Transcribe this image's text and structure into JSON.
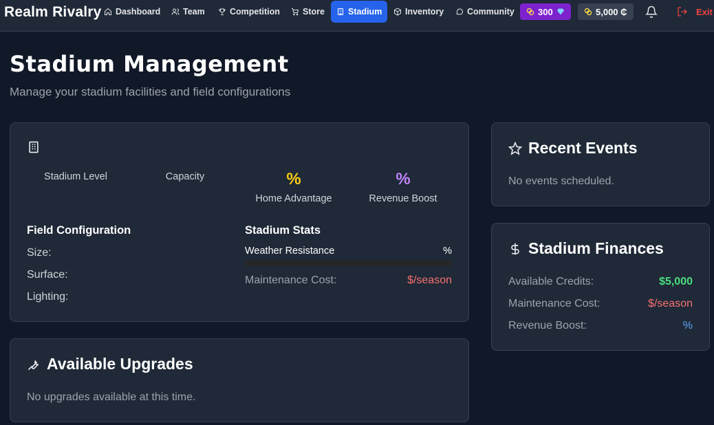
{
  "app": {
    "brand": "Realm Rivalry"
  },
  "nav": {
    "items": [
      {
        "label": "Dashboard",
        "icon": "home-icon"
      },
      {
        "label": "Team",
        "icon": "users-icon"
      },
      {
        "label": "Competition",
        "icon": "trophy-icon"
      },
      {
        "label": "Store",
        "icon": "cart-icon"
      },
      {
        "label": "Stadium",
        "icon": "building-icon",
        "active": true
      },
      {
        "label": "Inventory",
        "icon": "box-icon"
      },
      {
        "label": "Community",
        "icon": "chat-icon"
      }
    ],
    "gems": "300",
    "credits": "5,000 ₵",
    "exit_label": "Exit"
  },
  "header": {
    "title": "Stadium Management",
    "subtitle": "Manage your stadium facilities and field configurations"
  },
  "overview": {
    "stadium_level_label": "Stadium Level",
    "capacity_label": "Capacity",
    "home_advantage_value": "%",
    "home_advantage_label": "Home Advantage",
    "revenue_boost_value": "%",
    "revenue_boost_label": "Revenue Boost",
    "field_config": {
      "title": "Field Configuration",
      "size_label": "Size:",
      "surface_label": "Surface:",
      "lighting_label": "Lighting:"
    },
    "stats": {
      "title": "Stadium Stats",
      "weather_label": "Weather Resistance",
      "weather_value": "%",
      "weather_fill": 0,
      "maintenance_label": "Maintenance Cost:",
      "maintenance_value": "$/season"
    }
  },
  "upgrades": {
    "title": "Available Upgrades",
    "empty": "No upgrades available at this time."
  },
  "events": {
    "title": "Recent Events",
    "empty": "No events scheduled."
  },
  "finances": {
    "title": "Stadium Finances",
    "credits_label": "Available Credits:",
    "credits_value": "$5,000",
    "maintenance_label": "Maintenance Cost:",
    "maintenance_value": "$/season",
    "revenue_label": "Revenue Boost:",
    "revenue_value": "%"
  },
  "colors": {
    "background": "#111827",
    "card": "#1f2937",
    "accent": "#2563eb",
    "gems": "#7e22ce",
    "danger": "#ef4444",
    "success": "#4ade80"
  }
}
